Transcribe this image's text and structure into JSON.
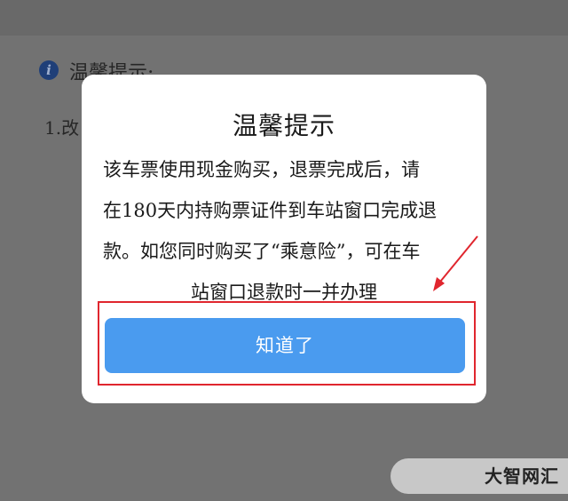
{
  "background": {
    "heading": "温馨提示:",
    "line1": "1.改"
  },
  "dialog": {
    "title": "温馨提示",
    "body_lines": [
      "该车票使用现金购买，退票完成后，请",
      "在180天内持购票证件到车站窗口完成退",
      "款。如您同时购买了“乘意险”，可在车",
      "站窗口退款时一并办理"
    ],
    "ok_label": "知道了"
  },
  "watermark": "大智网汇",
  "colors": {
    "button": "#4a9bef",
    "annotation": "#e0262e"
  }
}
